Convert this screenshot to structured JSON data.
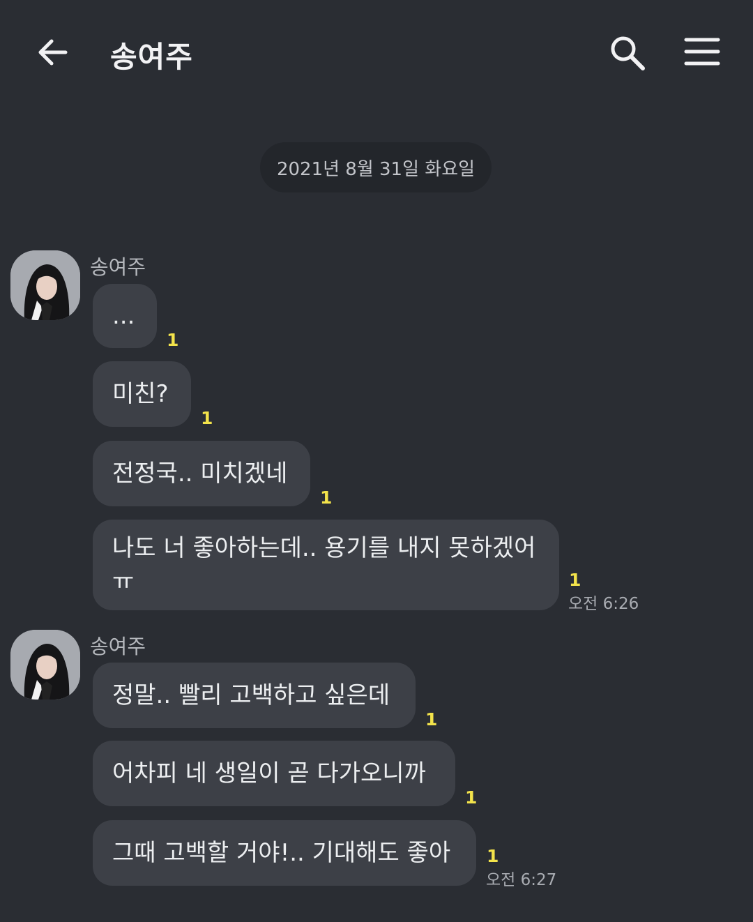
{
  "header": {
    "title": "송여주",
    "back_icon": "arrow-left-icon",
    "search_icon": "search-icon",
    "menu_icon": "hamburger-menu-icon"
  },
  "date_divider": "2021년 8월 31일 화요일",
  "groups": [
    {
      "sender": "송여주",
      "messages": [
        {
          "text": "...",
          "unread": "1"
        },
        {
          "text": "미친?",
          "unread": "1"
        },
        {
          "text": "전정국.. 미치겠네",
          "unread": "1"
        },
        {
          "text": "나도 너 좋아하는데.. 용기를 내지 못하겠어ㅠ",
          "unread": "1",
          "time": "오전 6:26"
        }
      ]
    },
    {
      "sender": "송여주",
      "messages": [
        {
          "text": "정말.. 빨리 고백하고 싶은데",
          "unread": "1"
        },
        {
          "text": "어차피 네 생일이 곧 다가오니까",
          "unread": "1"
        },
        {
          "text": "그때 고백할 거야!.. 기대해도 좋아",
          "unread": "1",
          "time": "오전 6:27"
        }
      ]
    }
  ],
  "colors": {
    "background": "#2a2d33",
    "bubble": "#3d4047",
    "unread": "#f3e34b",
    "date_pill": "#23262b"
  }
}
